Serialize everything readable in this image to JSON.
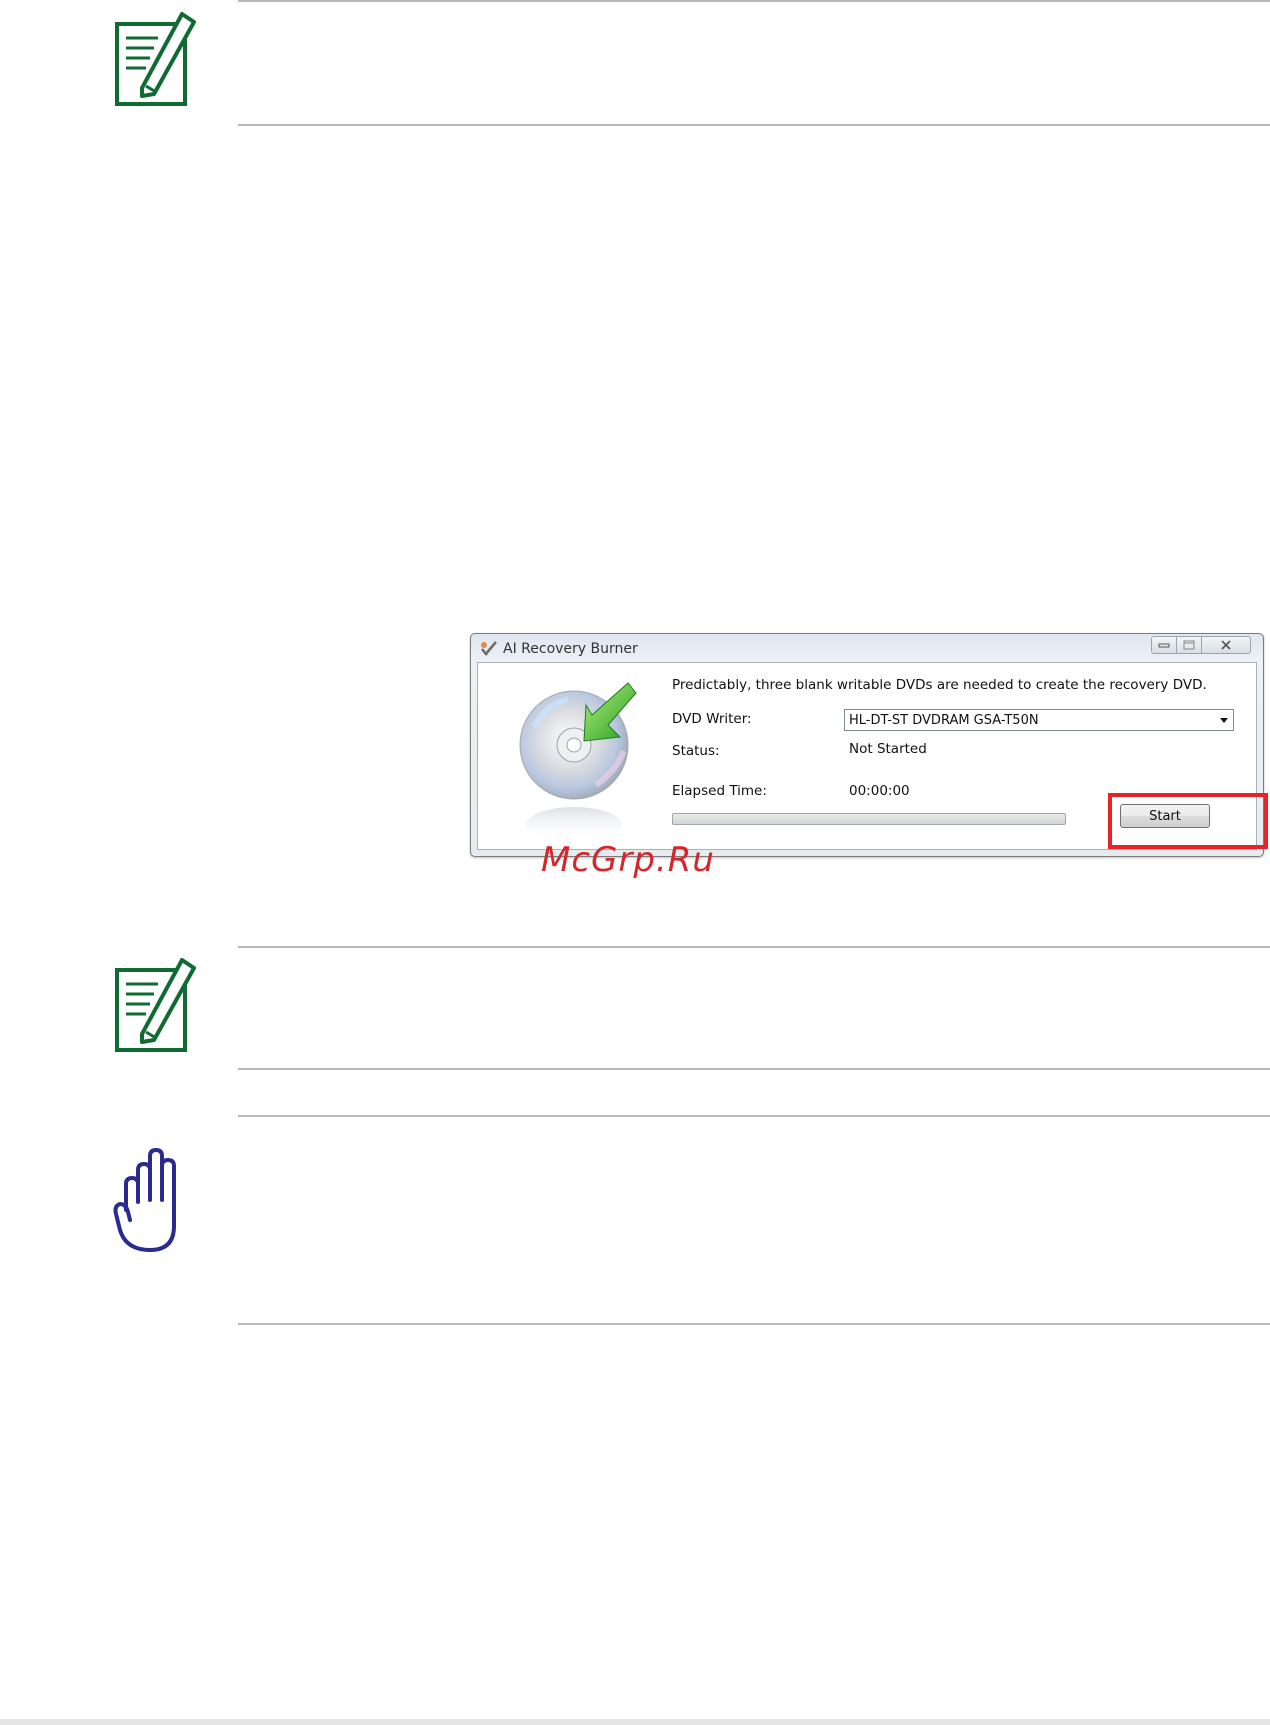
{
  "window": {
    "title": "AI Recovery Burner",
    "message": "Predictably, three blank writable DVDs are needed to create the recovery DVD.",
    "dvd_writer_label": "DVD Writer:",
    "dvd_writer_value": "HL-DT-ST DVDRAM GSA-T50N",
    "status_label": "Status:",
    "status_value": "Not Started",
    "elapsed_label": "Elapsed Time:",
    "elapsed_value": "00:00:00",
    "start_button": "Start",
    "progress": 0
  },
  "watermark": "McGrp.Ru",
  "colors": {
    "note_icon": "#0f6b31",
    "warning_icon": "#2a2a8f",
    "highlight": "#e52329",
    "rules": "#b9b9b9"
  },
  "icons": {
    "note": "note-pencil-icon",
    "warning": "hand-stop-icon"
  }
}
